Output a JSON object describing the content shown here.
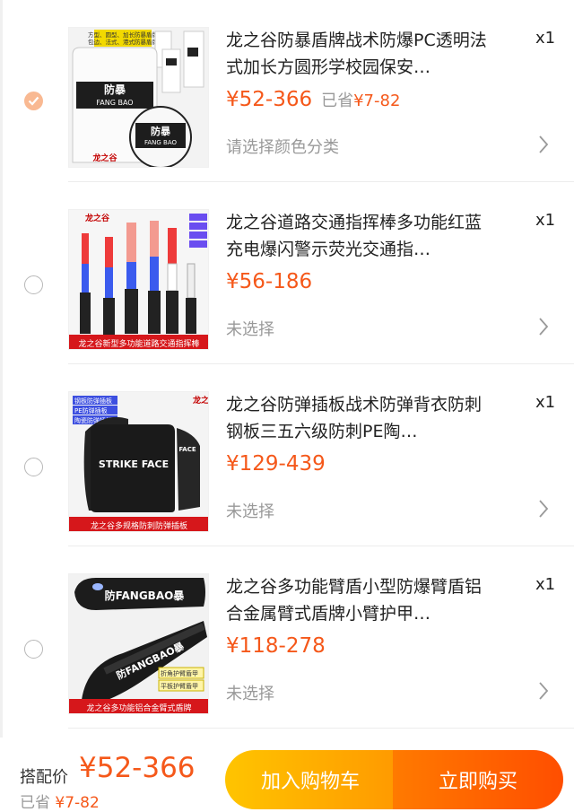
{
  "colors": {
    "accent": "#f5581a",
    "cart_button": "#ffb000",
    "buy_button": "#ff5a00",
    "checked_radio": "#f9b992"
  },
  "items": [
    {
      "checked": true,
      "title": "龙之谷防暴盾牌战术防爆PC透明法式加长方圆形学校园保安…",
      "qty": "x1",
      "price": "¥52-366",
      "saving_label": "已省",
      "saving_amount": "¥7-82",
      "option": "请选择颜色分类",
      "image": {
        "banner_line1": "方型、圆型、加长防暴盾牌",
        "banner_line2": "包边、法式、港式防暴盾牌",
        "shield_text": "防暴",
        "shield_sub": "FANG BAO",
        "brand": "龙之谷"
      }
    },
    {
      "checked": false,
      "title": "龙之谷道路交通指挥棒多功能红蓝充电爆闪警示荧光交通指…",
      "qty": "x1",
      "price": "¥56-186",
      "option": "未选择",
      "image": {
        "brand": "龙之谷",
        "caption": "龙之谷新型多功能道路交通指挥棒"
      }
    },
    {
      "checked": false,
      "title": "龙之谷防弹插板战术防弹背衣防刺钢板三五六级防刺PE陶…",
      "qty": "x1",
      "price": "¥129-439",
      "option": "未选择",
      "image": {
        "brand": "龙之谷",
        "tags": [
          "钢板防弹插板",
          "PE防弹插板",
          "陶瓷防弹插板"
        ],
        "plate_text": "STRIKE FACE",
        "plate_side": "FACE",
        "caption": "龙之谷多规格防刺防弹插板"
      }
    },
    {
      "checked": false,
      "title": "龙之谷多功能臂盾小型防爆臂盾铝合金属臂式盾牌小臂护甲…",
      "qty": "x1",
      "price": "¥118-278",
      "option": "未选择",
      "image": {
        "top_text": "防FANGBAO暴",
        "mid_text": "防FANGBAO暴",
        "tags": [
          "折角护臂盾甲",
          "平板护臂盾甲"
        ],
        "caption": "龙之谷多功能铝合金臂式盾牌"
      }
    }
  ],
  "bottom": {
    "combo_label": "搭配价",
    "combo_price": "¥52-366",
    "saving_label": "已省",
    "saving_amount": "¥7-82",
    "cart_button": "加入购物车",
    "buy_button": "立即购买"
  }
}
